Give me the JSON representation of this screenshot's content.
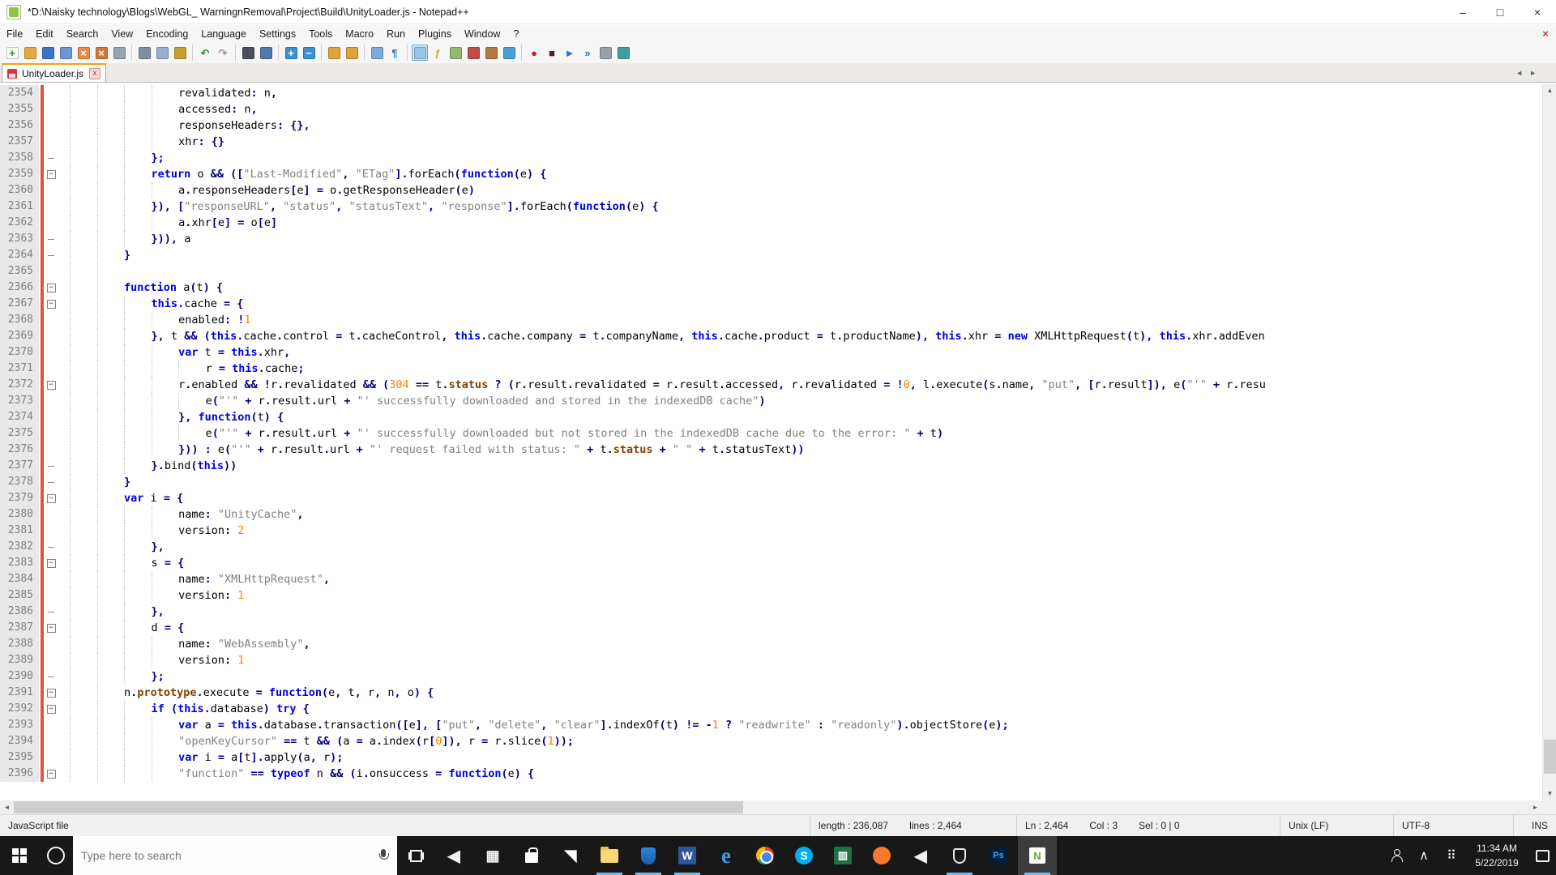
{
  "window": {
    "title": "*D:\\Naisky technology\\Blogs\\WebGL_ WarningnRemoval\\Project\\Build\\UnityLoader.js - Notepad++",
    "minimize_glyph": "–",
    "maximize_glyph": "□",
    "close_glyph": "×"
  },
  "menu": {
    "items": [
      "File",
      "Edit",
      "Search",
      "View",
      "Encoding",
      "Language",
      "Settings",
      "Tools",
      "Macro",
      "Run",
      "Plugins",
      "Window",
      "?"
    ],
    "close_doc_glyph": "×"
  },
  "toolbar": {
    "icons": [
      {
        "name": "new-file",
        "glyph": "+",
        "fg": "#1f8f1f",
        "bg": "#fbfbfb"
      },
      {
        "name": "open-file",
        "glyph": "",
        "fg": "",
        "bg": "#e7a93e"
      },
      {
        "name": "save-file",
        "glyph": "",
        "fg": "",
        "bg": "#3f74c4"
      },
      {
        "name": "save-all",
        "glyph": "",
        "fg": "",
        "bg": "#6f94d4"
      },
      {
        "name": "close-file",
        "glyph": "×",
        "fg": "#ffffff",
        "bg": "#e98b4c"
      },
      {
        "name": "close-all-files",
        "glyph": "×",
        "fg": "#ffffff",
        "bg": "#d4763a"
      },
      {
        "name": "print",
        "glyph": "",
        "fg": "",
        "bg": "#9aa4ae"
      },
      {
        "name": "cut",
        "glyph": "",
        "fg": "",
        "bg": "#7d8ea3",
        "sep": true
      },
      {
        "name": "copy",
        "glyph": "",
        "fg": "",
        "bg": "#97aecd"
      },
      {
        "name": "paste",
        "glyph": "",
        "fg": "",
        "bg": "#c79f2e"
      },
      {
        "name": "undo",
        "glyph": "↶",
        "fg": "#2a9d2a",
        "bg": "",
        "sep": true
      },
      {
        "name": "redo",
        "glyph": "↷",
        "fg": "#999999",
        "bg": ""
      },
      {
        "name": "find",
        "glyph": "",
        "fg": "",
        "bg": "#4d4f5c",
        "sep": true
      },
      {
        "name": "replace",
        "glyph": "",
        "fg": "",
        "bg": "#5577aa"
      },
      {
        "name": "zoom-in",
        "glyph": "+",
        "fg": "#ffffff",
        "bg": "#3f8fd4",
        "sep": true
      },
      {
        "name": "zoom-out",
        "glyph": "−",
        "fg": "#ffffff",
        "bg": "#3f8fd4"
      },
      {
        "name": "sync-vertical-scroll",
        "glyph": "",
        "fg": "",
        "bg": "#e0a23c",
        "sep": true
      },
      {
        "name": "sync-horizontal-scroll",
        "glyph": "",
        "fg": "",
        "bg": "#e0a23c"
      },
      {
        "name": "word-wrap",
        "glyph": "",
        "fg": "",
        "bg": "#7fa9d9",
        "sep": true
      },
      {
        "name": "show-all-characters",
        "glyph": "¶",
        "fg": "#2a6fd0",
        "bg": ""
      },
      {
        "name": "show-indent-guide",
        "glyph": "",
        "fg": "",
        "bg": "#9cc3e8",
        "sep": true,
        "active": true
      },
      {
        "name": "function-list",
        "glyph": "ƒ",
        "fg": "#caa53a",
        "bg": ""
      },
      {
        "name": "document-map",
        "glyph": "",
        "fg": "",
        "bg": "#8fba6f"
      },
      {
        "name": "document-switcher",
        "glyph": "",
        "fg": "",
        "bg": "#c44a4a"
      },
      {
        "name": "folder-as-workspace",
        "glyph": "",
        "fg": "",
        "bg": "#b07a42"
      },
      {
        "name": "file-monitoring",
        "glyph": "",
        "fg": "",
        "bg": "#4a9ed0"
      },
      {
        "name": "record-macro",
        "glyph": "●",
        "fg": "#cc2222",
        "bg": "",
        "sep": true
      },
      {
        "name": "stop-recording",
        "glyph": "■",
        "fg": "#5a2020",
        "bg": ""
      },
      {
        "name": "playback-macro",
        "glyph": "►",
        "fg": "#2a6fd0",
        "bg": ""
      },
      {
        "name": "run-macro-multiple-times",
        "glyph": "»",
        "fg": "#2a6fd0",
        "bg": ""
      },
      {
        "name": "save-recorded-macro",
        "glyph": "",
        "fg": "",
        "bg": "#9aa0a8"
      },
      {
        "name": "search-results-window",
        "glyph": "",
        "fg": "",
        "bg": "#3f9f9f"
      }
    ]
  },
  "tabs": {
    "active_label": "UnityLoader.js",
    "close_glyph": "x",
    "left_arrow": "◄",
    "right_arrow": "►"
  },
  "editor": {
    "lines": [
      {
        "n": 2354,
        "fold": "",
        "t": "                revalidated: n,"
      },
      {
        "n": 2355,
        "fold": "",
        "t": "                accessed: n,"
      },
      {
        "n": 2356,
        "fold": "",
        "t": "                responseHeaders: {},"
      },
      {
        "n": 2357,
        "fold": "",
        "t": "                xhr: {}"
      },
      {
        "n": 2358,
        "fold": "end",
        "t": "            };"
      },
      {
        "n": 2359,
        "fold": "box",
        "t": "            return o && ([\"Last-Modified\", \"ETag\"].forEach(function(e) {"
      },
      {
        "n": 2360,
        "fold": "",
        "t": "                a.responseHeaders[e] = o.getResponseHeader(e)"
      },
      {
        "n": 2361,
        "fold": "",
        "t": "            }), [\"responseURL\", \"status\", \"statusText\", \"response\"].forEach(function(e) {"
      },
      {
        "n": 2362,
        "fold": "",
        "t": "                a.xhr[e] = o[e]"
      },
      {
        "n": 2363,
        "fold": "end",
        "t": "            })), a"
      },
      {
        "n": 2364,
        "fold": "end",
        "t": "        }"
      },
      {
        "n": 2365,
        "fold": "",
        "t": "        "
      },
      {
        "n": 2366,
        "fold": "box",
        "t": "        function a(t) {"
      },
      {
        "n": 2367,
        "fold": "box",
        "t": "            this.cache = {"
      },
      {
        "n": 2368,
        "fold": "",
        "t": "                enabled: !1"
      },
      {
        "n": 2369,
        "fold": "",
        "t": "            }, t && (this.cache.control = t.cacheControl, this.cache.company = t.companyName, this.cache.product = t.productName), this.xhr = new XMLHttpRequest(t), this.xhr.addEven"
      },
      {
        "n": 2370,
        "fold": "",
        "t": "                var t = this.xhr,"
      },
      {
        "n": 2371,
        "fold": "",
        "t": "                    r = this.cache;"
      },
      {
        "n": 2372,
        "fold": "box",
        "t": "                r.enabled && !r.revalidated && (304 == t.status ? (r.result.revalidated = r.result.accessed, r.revalidated = !0, l.execute(s.name, \"put\", [r.result]), e(\"'\" + r.resu"
      },
      {
        "n": 2373,
        "fold": "",
        "t": "                    e(\"'\" + r.result.url + \"' successfully downloaded and stored in the indexedDB cache\")"
      },
      {
        "n": 2374,
        "fold": "",
        "t": "                }, function(t) {"
      },
      {
        "n": 2375,
        "fold": "",
        "t": "                    e(\"'\" + r.result.url + \"' successfully downloaded but not stored in the indexedDB cache due to the error: \" + t)"
      },
      {
        "n": 2376,
        "fold": "",
        "t": "                })) : e(\"'\" + r.result.url + \"' request failed with status: \" + t.status + \" \" + t.statusText))"
      },
      {
        "n": 2377,
        "fold": "end",
        "t": "            }.bind(this))"
      },
      {
        "n": 2378,
        "fold": "end",
        "t": "        }"
      },
      {
        "n": 2379,
        "fold": "box",
        "t": "        var i = {"
      },
      {
        "n": 2380,
        "fold": "",
        "t": "                name: \"UnityCache\","
      },
      {
        "n": 2381,
        "fold": "",
        "t": "                version: 2"
      },
      {
        "n": 2382,
        "fold": "end",
        "t": "            },"
      },
      {
        "n": 2383,
        "fold": "box",
        "t": "            s = {"
      },
      {
        "n": 2384,
        "fold": "",
        "t": "                name: \"XMLHttpRequest\","
      },
      {
        "n": 2385,
        "fold": "",
        "t": "                version: 1"
      },
      {
        "n": 2386,
        "fold": "end",
        "t": "            },"
      },
      {
        "n": 2387,
        "fold": "box",
        "t": "            d = {"
      },
      {
        "n": 2388,
        "fold": "",
        "t": "                name: \"WebAssembly\","
      },
      {
        "n": 2389,
        "fold": "",
        "t": "                version: 1"
      },
      {
        "n": 2390,
        "fold": "end",
        "t": "            };"
      },
      {
        "n": 2391,
        "fold": "box",
        "t": "        n.prototype.execute = function(e, t, r, n, o) {"
      },
      {
        "n": 2392,
        "fold": "box",
        "t": "            if (this.database) try {"
      },
      {
        "n": 2393,
        "fold": "",
        "t": "                var a = this.database.transaction([e], [\"put\", \"delete\", \"clear\"].indexOf(t) != -1 ? \"readwrite\" : \"readonly\").objectStore(e);"
      },
      {
        "n": 2394,
        "fold": "",
        "t": "                \"openKeyCursor\" == t && (a = a.index(r[0]), r = r.slice(1));"
      },
      {
        "n": 2395,
        "fold": "",
        "t": "                var i = a[t].apply(a, r);"
      },
      {
        "n": 2396,
        "fold": "box",
        "t": "                \"function\" == typeof n && (i.onsuccess = function(e) {"
      }
    ]
  },
  "scrollbars": {
    "up_glyph": "▲",
    "down_glyph": "▼",
    "left_glyph": "◄",
    "right_glyph": "►"
  },
  "status": {
    "doc_type": "JavaScript file",
    "length": "length : 236,087",
    "lines": "lines : 2,464",
    "ln": "Ln : 2,464",
    "col": "Col : 3",
    "sel": "Sel : 0 | 0",
    "eol": "Unix (LF)",
    "encoding": "UTF-8",
    "mode": "INS"
  },
  "taskbar": {
    "search_placeholder": "Type here to search",
    "apps": [
      {
        "name": "unity",
        "glyph": "◀",
        "running": false,
        "active": false
      },
      {
        "name": "calculator",
        "glyph": "▦",
        "running": false,
        "active": false
      },
      {
        "name": "store",
        "glyph": "",
        "running": false,
        "active": false
      },
      {
        "name": "mail",
        "glyph": "◥",
        "running": false,
        "active": false
      },
      {
        "name": "file-explorer",
        "glyph": "",
        "running": true,
        "active": false
      },
      {
        "name": "defender",
        "glyph": "",
        "running": true,
        "active": false
      },
      {
        "name": "word",
        "glyph": "W",
        "running": true,
        "active": false
      },
      {
        "name": "edge",
        "glyph": "e",
        "running": false,
        "active": false
      },
      {
        "name": "chrome",
        "glyph": "",
        "running": false,
        "active": false
      },
      {
        "name": "skype",
        "glyph": "S",
        "running": false,
        "active": false
      },
      {
        "name": "excel",
        "glyph": "▥",
        "running": false,
        "active": false
      },
      {
        "name": "blender",
        "glyph": "",
        "running": false,
        "active": false
      },
      {
        "name": "media-player",
        "glyph": "◀",
        "running": false,
        "active": false
      },
      {
        "name": "security-shield",
        "glyph": "",
        "running": true,
        "active": false
      },
      {
        "name": "photoshop",
        "glyph": "Ps",
        "running": false,
        "active": false
      },
      {
        "name": "notepadpp",
        "glyph": "N",
        "running": true,
        "active": true
      }
    ],
    "tray": {
      "chevron_glyph": "∧",
      "grid_glyph": "⠿",
      "time": "11:34 AM",
      "date": "5/22/2019"
    }
  },
  "colors": {
    "tab_accent": "#f7a30b",
    "change_marker": "#e8503a",
    "running_underline": "#76b9ed",
    "keyword": "#0000e0",
    "string": "#808080",
    "number": "#ff8000",
    "operator": "#000080",
    "word2": "#804000"
  }
}
